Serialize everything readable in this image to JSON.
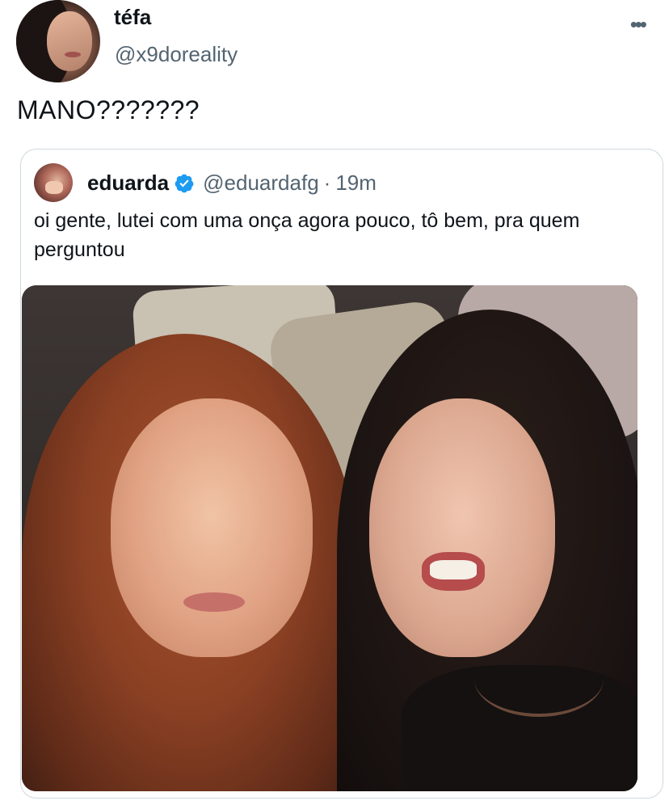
{
  "tweet": {
    "display_name": "téfa",
    "handle": "@x9doreality",
    "text": "MANO???????",
    "more_icon": "more-horizontal-icon"
  },
  "quoted_tweet": {
    "display_name": "eduarda",
    "verified": true,
    "verified_color": "#1d9bf0",
    "handle": "@eduardafg",
    "separator": "·",
    "time": "19m",
    "text": "oi gente, lutei com uma onça agora pouco, tô bem, pra quem perguntou",
    "media": "photo"
  },
  "colors": {
    "text_primary": "#0f1419",
    "text_secondary": "#536471",
    "border": "#cfd9de",
    "accent": "#1d9bf0"
  }
}
